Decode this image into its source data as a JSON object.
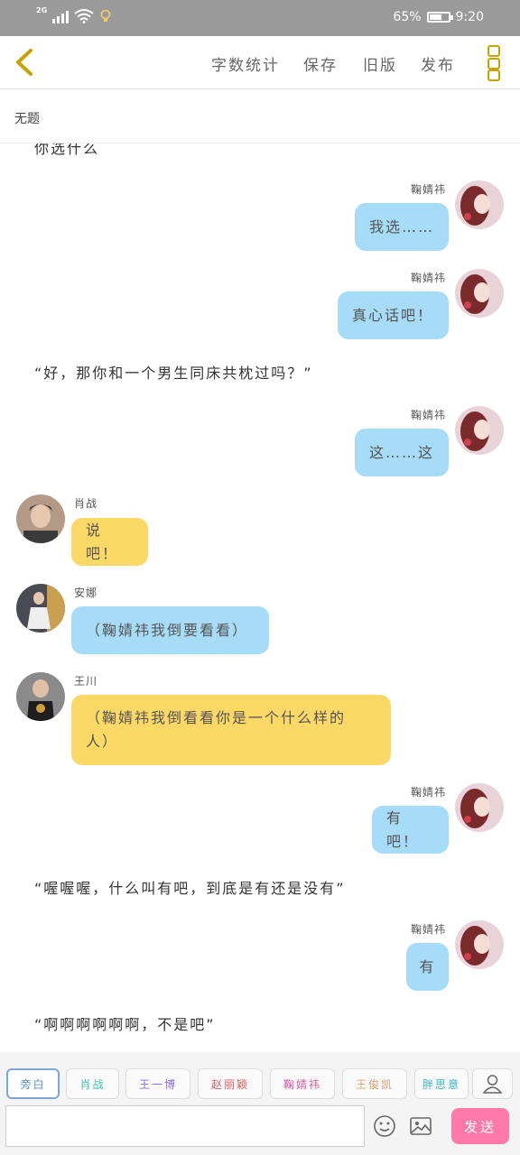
{
  "status": {
    "network": "2G",
    "battery": "65%",
    "battery_level": 0.65,
    "time": "9:20"
  },
  "header": {
    "back_icon": "chevron-left-icon",
    "word_count": "字数统计",
    "save": "保存",
    "old_version": "旧版",
    "publish": "发布",
    "menu_icon": "more-vertical-icon",
    "accent": "#c8a200"
  },
  "doc": {
    "title": "无题"
  },
  "chat": {
    "cut_narration": "你选什么",
    "messages": [
      {
        "kind": "right",
        "name": "鞠婧祎",
        "text": "我选……"
      },
      {
        "kind": "right",
        "name": "鞠婧祎",
        "text": "真心话吧！"
      },
      {
        "kind": "narration",
        "text": "“好，那你和一个男生同床共枕过吗？”"
      },
      {
        "kind": "right",
        "name": "鞠婧祎",
        "text": "这……这"
      },
      {
        "kind": "left",
        "name": "肖战",
        "text": "说吧！"
      },
      {
        "kind": "left",
        "name": "安娜",
        "text": "（鞠婧祎我倒要看看）"
      },
      {
        "kind": "left",
        "name": "王川",
        "text_line1": "（鞠婧祎我倒看看你是一个什么样的",
        "text_line2": "人）"
      },
      {
        "kind": "right",
        "name": "鞠婧祎",
        "text": "有吧！"
      },
      {
        "kind": "narration",
        "text": "“喔喔喔，什么叫有吧，到底是有还是没有”"
      },
      {
        "kind": "right",
        "name": "鞠婧祎",
        "text": "有"
      },
      {
        "kind": "narration",
        "text": "“啊啊啊啊啊啊，不是吧”"
      }
    ],
    "colors": {
      "blue_bubble": "#a6dcf7",
      "yellow_bubble": "#fcd866"
    }
  },
  "roles": [
    {
      "label": "旁白",
      "color": "#5b8fd0",
      "active": true
    },
    {
      "label": "肖战",
      "color": "#3cbfb0"
    },
    {
      "label": "王一博",
      "color": "#8a6fe0"
    },
    {
      "label": "赵丽颖",
      "color": "#e05a5a"
    },
    {
      "label": "鞠婧祎",
      "color": "#e05aa0"
    },
    {
      "label": "王俊凯",
      "color": "#e0a070"
    },
    {
      "label": "胖思意",
      "color": "#3cb6c8"
    }
  ],
  "composer": {
    "input_value": "",
    "emoji_icon": "emoji-icon",
    "image_icon": "image-icon",
    "person_icon": "person-icon",
    "send": "发送",
    "send_color": "#ff79a8"
  }
}
